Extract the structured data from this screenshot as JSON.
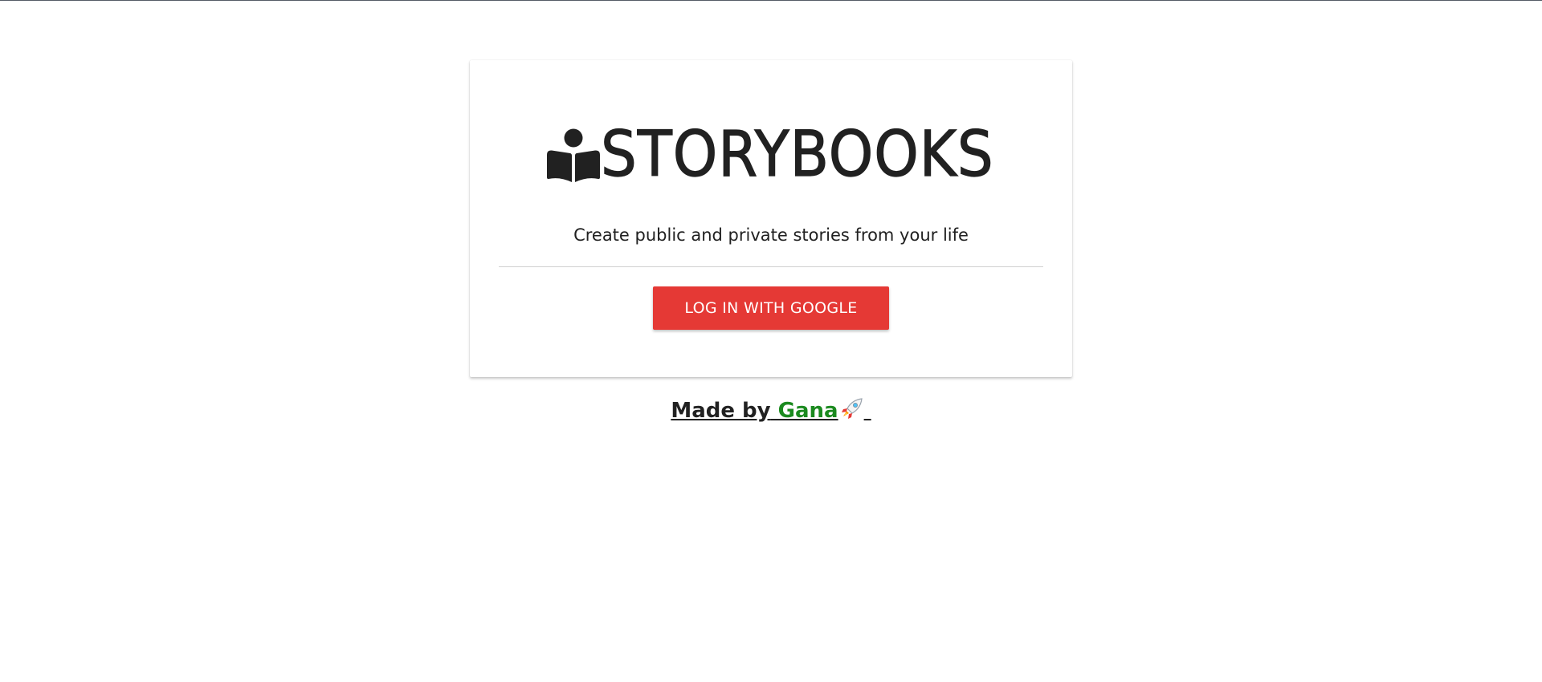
{
  "app": {
    "logo_text": "STORYBOOKS",
    "logo_icon": "reader-book-icon"
  },
  "card": {
    "tagline": "Create public and private stories from your life",
    "login_button_label": "LOG IN WITH GOOGLE"
  },
  "footer": {
    "made_by_prefix": "Made by",
    "author_name": " Gana",
    "rocket_icon": "rocket-icon"
  },
  "colors": {
    "button": "#e53935",
    "author": "#1b8a1f",
    "text": "#212121"
  }
}
